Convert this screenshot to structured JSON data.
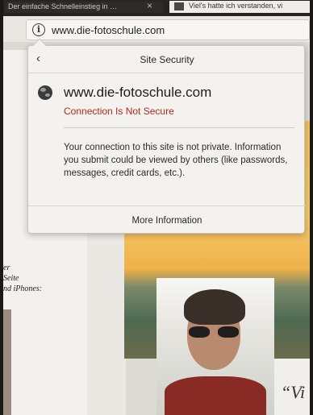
{
  "tabs": {
    "left_title": "Der einfache Schnelleinstieg in …",
    "right_title": "Viel's hatte ich verstanden, vi"
  },
  "address_bar": {
    "url": "www.die-fotoschule.com"
  },
  "popup": {
    "title": "Site Security",
    "host": "www.die-fotoschule.com",
    "status": "Connection Is Not Secure",
    "description": "Your connection to this site is not private. Information you submit could be viewed by others (like passwords, messages, credit cards, etc.).",
    "more_info_label": "More Information",
    "status_color": "#b22a1f"
  },
  "background_page": {
    "left_text_line1": "er",
    "left_text_line2": "Seite",
    "left_text_line3": "nd iPhones:",
    "quote_fragment": "“Vi"
  },
  "icons": {
    "info": "info-icon",
    "back": "chevron-left-icon",
    "globe": "globe-icon"
  }
}
